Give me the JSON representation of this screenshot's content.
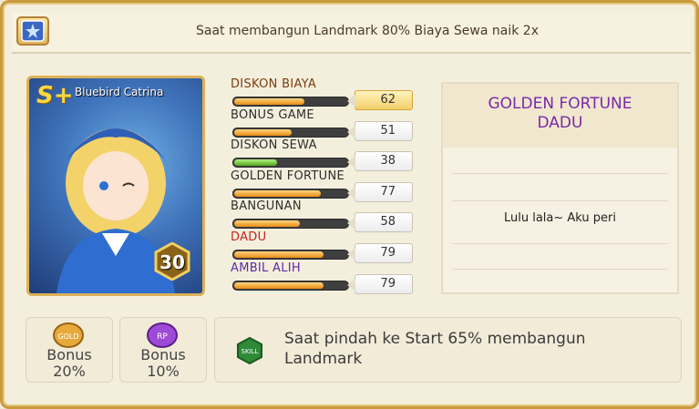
{
  "top_banner": {
    "text": "Saat membangun Landmark 80% Biaya Sewa naik 2x",
    "badge_icon": "card-swap-icon"
  },
  "character": {
    "name": "Bluebird Catrina",
    "rank": "S+",
    "level": "30"
  },
  "stats": [
    {
      "label": "DISKON BIAYA",
      "value": "62",
      "fill": 0.62,
      "color": "#7a3d0f",
      "highlight": true
    },
    {
      "label": "BONUS GAME",
      "value": "51",
      "fill": 0.51,
      "color": "#2d2d2d"
    },
    {
      "label": "DISKON SEWA",
      "value": "38",
      "fill": 0.38,
      "color": "#2d2d2d",
      "bar": "green"
    },
    {
      "label": "GOLDEN FORTUNE",
      "value": "77",
      "fill": 0.77,
      "color": "#2d2d2d"
    },
    {
      "label": "BANGUNAN",
      "value": "58",
      "fill": 0.58,
      "color": "#2d2d2d"
    },
    {
      "label": "DADU",
      "value": "79",
      "fill": 0.79,
      "color": "#c0261c"
    },
    {
      "label": "AMBIL ALIH",
      "value": "79",
      "fill": 0.79,
      "color": "#5b2aa6"
    }
  ],
  "skill_card": {
    "title_line1": "GOLDEN FORTUNE",
    "title_line2": "DADU",
    "description": "Lulu lala~ Aku peri"
  },
  "bonuses": [
    {
      "icon_text": "GOLD",
      "label_line1": "Bonus",
      "label_line2": "20%"
    },
    {
      "icon_text": "RP",
      "label_line1": "Bonus",
      "label_line2": "10%"
    }
  ],
  "skill": {
    "icon_text": "SKILL",
    "text": "Saat pindah ke Start 65% membangun Landmark"
  }
}
